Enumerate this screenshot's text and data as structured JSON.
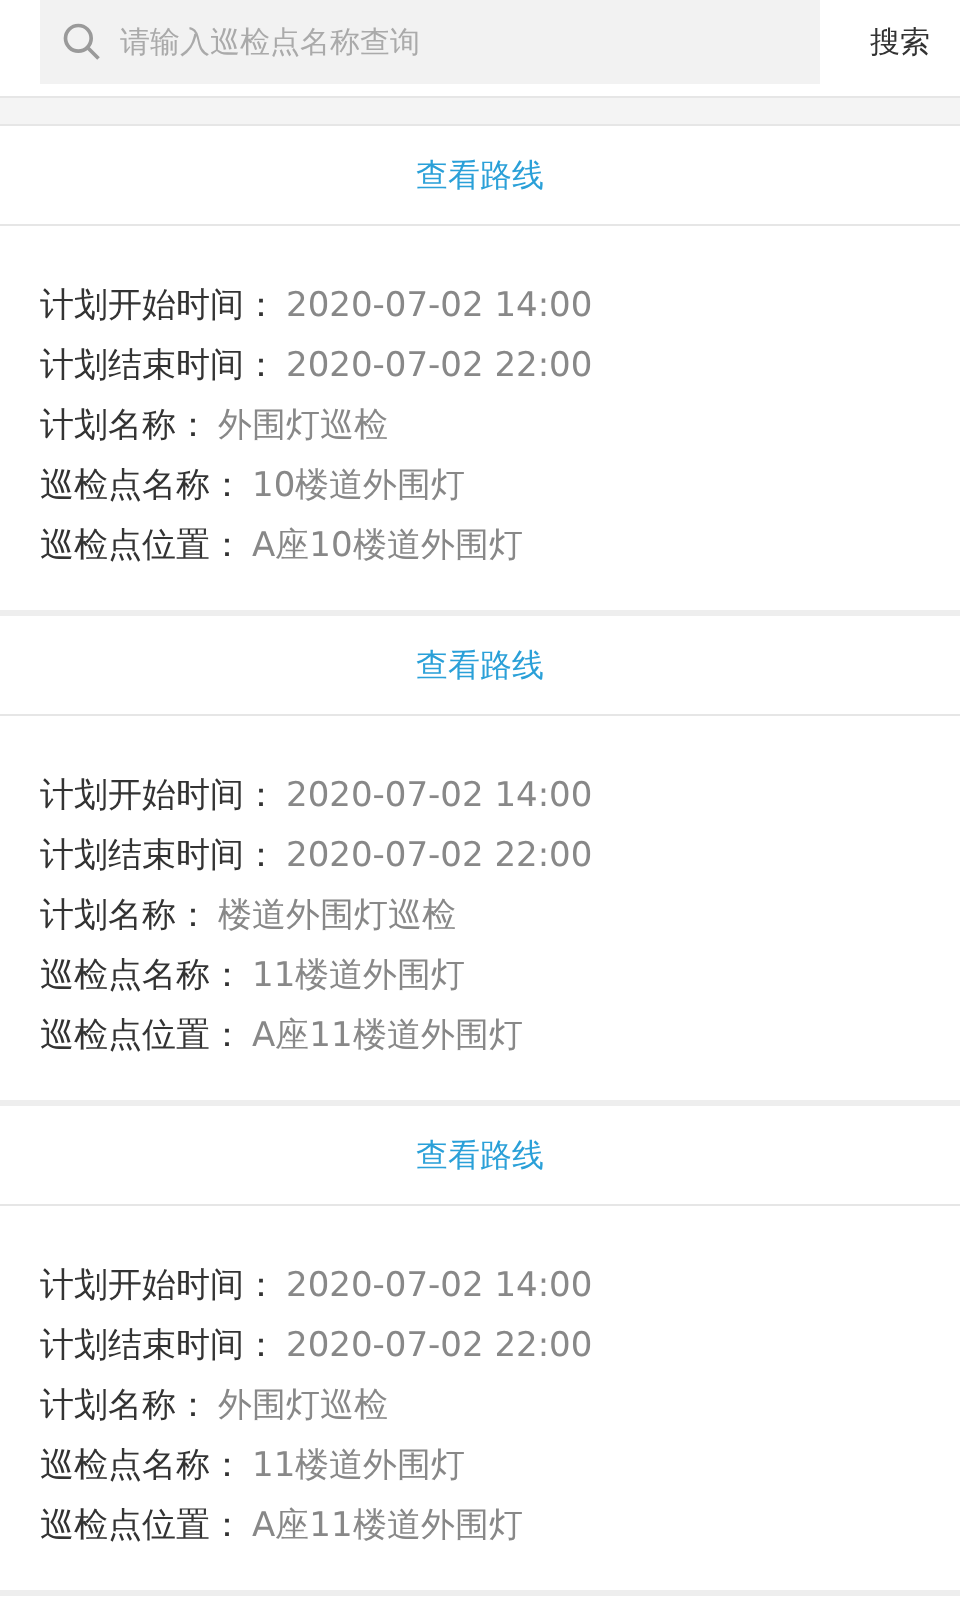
{
  "search": {
    "placeholder": "请输入巡检点名称查询",
    "button": "搜索"
  },
  "plans": [
    {
      "link": "查看路线",
      "fields": [
        {
          "label": "计划开始时间：",
          "value": "2020-07-02 14:00"
        },
        {
          "label": "计划结束时间：",
          "value": "2020-07-02 22:00"
        },
        {
          "label": "计划名称：",
          "value": "外围灯巡检"
        },
        {
          "label": "巡检点名称：",
          "value": "10楼道外围灯"
        },
        {
          "label": "巡检点位置：",
          "value": "A座10楼道外围灯"
        }
      ]
    },
    {
      "link": "查看路线",
      "fields": [
        {
          "label": "计划开始时间：",
          "value": "2020-07-02 14:00"
        },
        {
          "label": "计划结束时间：",
          "value": "2020-07-02 22:00"
        },
        {
          "label": "计划名称：",
          "value": "楼道外围灯巡检"
        },
        {
          "label": "巡检点名称：",
          "value": "11楼道外围灯"
        },
        {
          "label": "巡检点位置：",
          "value": "A座11楼道外围灯"
        }
      ]
    },
    {
      "link": "查看路线",
      "fields": [
        {
          "label": "计划开始时间：",
          "value": "2020-07-02 14:00"
        },
        {
          "label": "计划结束时间：",
          "value": "2020-07-02 22:00"
        },
        {
          "label": "计划名称：",
          "value": "外围灯巡检"
        },
        {
          "label": "巡检点名称：",
          "value": "11楼道外围灯"
        },
        {
          "label": "巡检点位置：",
          "value": "A座11楼道外围灯"
        }
      ]
    }
  ]
}
